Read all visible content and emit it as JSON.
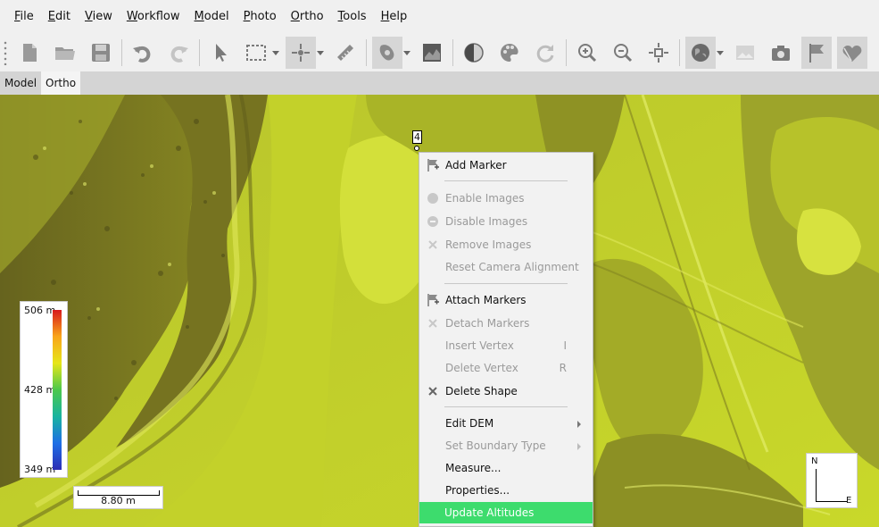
{
  "menubar": [
    "File",
    "Edit",
    "View",
    "Workflow",
    "Model",
    "Photo",
    "Ortho",
    "Tools",
    "Help"
  ],
  "toolbar": {
    "buttons": [
      "new-icon",
      "open-icon",
      "save-icon",
      "undo-icon",
      "redo-icon",
      "navigation-icon",
      "rectangle-selection-icon",
      "marker-tool-icon",
      "ruler-icon",
      "shape-icon",
      "dem-icon",
      "brightness-icon",
      "palette-icon",
      "rotate-icon",
      "zoom-in-icon",
      "zoom-out-icon",
      "reset-view-icon",
      "globe-icon",
      "image-icon",
      "camera-icon",
      "flag-icon",
      "shape-heart-icon"
    ]
  },
  "tabs": [
    "Model",
    "Ortho"
  ],
  "active_tab": "Ortho",
  "legend": {
    "max": "506 m",
    "mid": "428 m",
    "min": "349 m"
  },
  "scale": "8.80 m",
  "north": {
    "n": "N",
    "e": "E"
  },
  "marker": {
    "label": "4"
  },
  "context_menu": {
    "items": [
      {
        "label": "Add Marker",
        "disabled": false,
        "icon": "add-marker-icon"
      },
      {
        "label": "Enable Images",
        "disabled": true,
        "icon": "enable-icon"
      },
      {
        "label": "Disable Images",
        "disabled": true,
        "icon": "disable-icon"
      },
      {
        "label": "Remove Images",
        "disabled": true,
        "icon": "remove-icon"
      },
      {
        "label": "Reset Camera Alignment",
        "disabled": true,
        "icon": ""
      },
      {
        "label": "Attach Markers",
        "disabled": false,
        "icon": "attach-marker-icon"
      },
      {
        "label": "Detach Markers",
        "disabled": true,
        "icon": "detach-icon"
      },
      {
        "label": "Insert Vertex",
        "disabled": true,
        "icon": "",
        "shortcut": "I"
      },
      {
        "label": "Delete Vertex",
        "disabled": true,
        "icon": "",
        "shortcut": "R"
      },
      {
        "label": "Delete Shape",
        "disabled": false,
        "icon": "delete-icon"
      },
      {
        "label": "Edit DEM",
        "disabled": false,
        "submenu": true
      },
      {
        "label": "Set Boundary Type",
        "disabled": true,
        "submenu": true
      },
      {
        "label": "Measure...",
        "disabled": false
      },
      {
        "label": "Properties...",
        "disabled": false
      },
      {
        "label": "Update Altitudes",
        "disabled": false,
        "highlighted": true
      }
    ]
  },
  "colors": {
    "highlight": "#3ddc6d",
    "terrain_light": "#c8d62a",
    "terrain_dark": "#5b5a1e"
  }
}
